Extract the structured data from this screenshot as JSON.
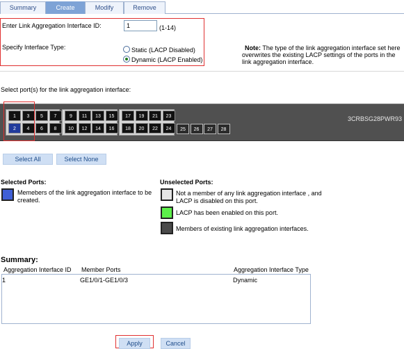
{
  "tabs": [
    {
      "label": "Summary",
      "active": false
    },
    {
      "label": "Create",
      "active": true
    },
    {
      "label": "Modify",
      "active": false
    },
    {
      "label": "Remove",
      "active": false
    }
  ],
  "form": {
    "id_label": "Enter Link Aggregation Interface ID:",
    "id_value": "1",
    "id_range": "(1-14)",
    "type_label": "Specify Interface Type:",
    "option_static": "Static (LACP Disabled)",
    "option_dynamic": "Dynamic (LACP Enabled)",
    "selected_type": "dynamic",
    "note_label": "Note:",
    "note_text": "The type of the link aggregation interface set here overwrites the existing LACP settings of the ports in the link aggregation interface."
  },
  "ports": {
    "select_label": "Select port(s) for the link aggregation interface:",
    "model": "3CRBSG28PWR93",
    "top_row": [
      "1",
      "3",
      "5",
      "7",
      "9",
      "11",
      "13",
      "15",
      "17",
      "19",
      "21",
      "23"
    ],
    "bottom_row": [
      "2",
      "4",
      "6",
      "8",
      "10",
      "12",
      "14",
      "16",
      "18",
      "20",
      "22",
      "24"
    ],
    "sfp": [
      "25",
      "26",
      "27",
      "28"
    ],
    "selected": [
      "2"
    ],
    "select_all": "Select All",
    "select_none": "Select None"
  },
  "legend": {
    "selected_title": "Selected Ports:",
    "selected_desc": "Memebers of the link aggregation interface to be created.",
    "unselected_title": "Unselected Ports:",
    "unselected_1": "Not a member of any link aggregation interface , and LACP is disabled on this port.",
    "unselected_2": "LACP has been enabled on this port.",
    "unselected_3": "Members of existing link aggregation interfaces.",
    "colors": {
      "selected": "#3f5fd6",
      "none": "#e4e4e4",
      "lacp": "#5cf04a",
      "member": "#4a4a4a"
    }
  },
  "summary": {
    "title": "Summary:",
    "columns": [
      "Aggregation Interface ID",
      "Member Ports",
      "Aggregation Interface Type"
    ],
    "rows": [
      [
        "1",
        "GE1/0/1-GE1/0/3",
        "Dynamic"
      ]
    ]
  },
  "actions": {
    "apply": "Apply",
    "cancel": "Cancel"
  }
}
